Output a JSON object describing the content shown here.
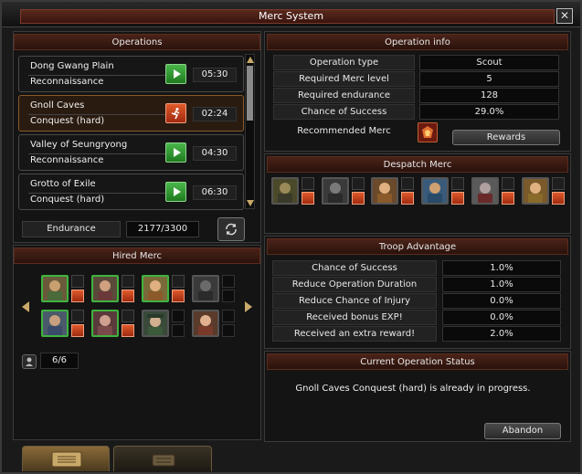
{
  "window": {
    "title": "Merc System"
  },
  "operations": {
    "header": "Operations",
    "items": [
      {
        "name": "Dong Gwang Plain",
        "type": "Reconnaissance",
        "time": "05:30",
        "action": "play"
      },
      {
        "name": "Gnoll Caves",
        "type": "Conquest (hard)",
        "time": "02:24",
        "action": "running"
      },
      {
        "name": "Valley of Seungryong",
        "type": "Reconnaissance",
        "time": "04:30",
        "action": "play"
      },
      {
        "name": "Grotto of Exile",
        "type": "Conquest (hard)",
        "time": "06:30",
        "action": "play"
      }
    ],
    "endurance_label": "Endurance",
    "endurance_value": "2177/3300"
  },
  "hired_merc": {
    "header": "Hired Merc",
    "count": "6/6"
  },
  "operation_info": {
    "header": "Operation info",
    "rows": [
      {
        "label": "Operation type",
        "value": "Scout"
      },
      {
        "label": "Required Merc level",
        "value": "5"
      },
      {
        "label": "Required endurance",
        "value": "128"
      },
      {
        "label": "Chance of Success",
        "value": "29.0%"
      }
    ],
    "recommended_label": "Recommended Merc",
    "rewards_label": "Rewards"
  },
  "despatch": {
    "header": "Despatch Merc"
  },
  "troop_advantage": {
    "header": "Troop Advantage",
    "rows": [
      {
        "label": "Chance of Success",
        "value": "1.0%"
      },
      {
        "label": "Reduce Operation Duration",
        "value": "1.0%"
      },
      {
        "label": "Reduce Chance of Injury",
        "value": "0.0%"
      },
      {
        "label": "Received bonus EXP!",
        "value": "0.0%"
      },
      {
        "label": "Received an extra reward!",
        "value": "2.0%"
      }
    ]
  },
  "status": {
    "header": "Current Operation Status",
    "message": "Gnoll Caves Conquest (hard) is already in progress.",
    "abandon_label": "Abandon"
  },
  "colors": {
    "accent": "#5b2c1e",
    "play": "#2f9a2f",
    "running": "#c6431c",
    "hired_border": "#3fb33f"
  }
}
